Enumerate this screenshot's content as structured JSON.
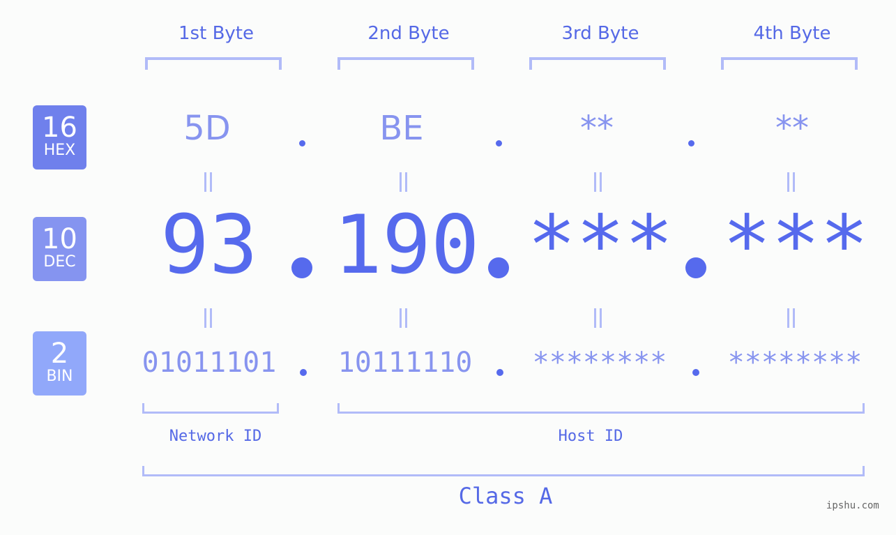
{
  "byte_headers": [
    "1st Byte",
    "2nd Byte",
    "3rd Byte",
    "4th Byte"
  ],
  "badges": [
    {
      "number": "16",
      "label": "HEX",
      "color": "#6f80ec"
    },
    {
      "number": "10",
      "label": "DEC",
      "color": "#8594f0"
    },
    {
      "number": "2",
      "label": "BIN",
      "color": "#91a8fa"
    }
  ],
  "hex": [
    "5D",
    "BE",
    "**",
    "**"
  ],
  "dec": [
    "93",
    "190",
    "***",
    "***"
  ],
  "bin": [
    "01011101",
    "10111110",
    "********",
    "********"
  ],
  "network_label": "Network ID",
  "host_label": "Host ID",
  "class_label": "Class A",
  "watermark": "ipshu.com",
  "colors": {
    "primary": "#566aed",
    "light": "#8794ef",
    "bracket": "#b1bbf8"
  }
}
